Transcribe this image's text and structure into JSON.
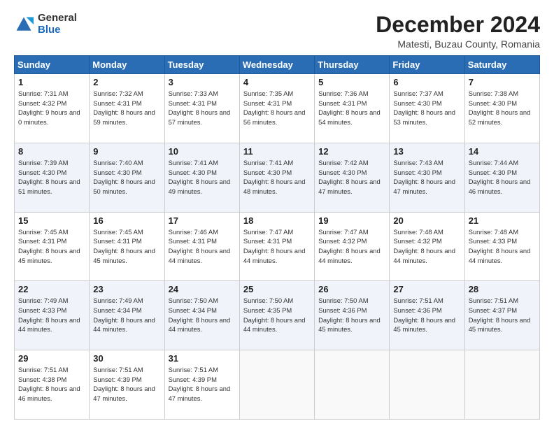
{
  "logo": {
    "general": "General",
    "blue": "Blue"
  },
  "header": {
    "title": "December 2024",
    "subtitle": "Matesti, Buzau County, Romania"
  },
  "days_of_week": [
    "Sunday",
    "Monday",
    "Tuesday",
    "Wednesday",
    "Thursday",
    "Friday",
    "Saturday"
  ],
  "weeks": [
    [
      {
        "day": 1,
        "sunrise": "7:31 AM",
        "sunset": "4:32 PM",
        "daylight": "9 hours and 0 minutes."
      },
      {
        "day": 2,
        "sunrise": "7:32 AM",
        "sunset": "4:31 PM",
        "daylight": "8 hours and 59 minutes."
      },
      {
        "day": 3,
        "sunrise": "7:33 AM",
        "sunset": "4:31 PM",
        "daylight": "8 hours and 57 minutes."
      },
      {
        "day": 4,
        "sunrise": "7:35 AM",
        "sunset": "4:31 PM",
        "daylight": "8 hours and 56 minutes."
      },
      {
        "day": 5,
        "sunrise": "7:36 AM",
        "sunset": "4:31 PM",
        "daylight": "8 hours and 54 minutes."
      },
      {
        "day": 6,
        "sunrise": "7:37 AM",
        "sunset": "4:30 PM",
        "daylight": "8 hours and 53 minutes."
      },
      {
        "day": 7,
        "sunrise": "7:38 AM",
        "sunset": "4:30 PM",
        "daylight": "8 hours and 52 minutes."
      }
    ],
    [
      {
        "day": 8,
        "sunrise": "7:39 AM",
        "sunset": "4:30 PM",
        "daylight": "8 hours and 51 minutes."
      },
      {
        "day": 9,
        "sunrise": "7:40 AM",
        "sunset": "4:30 PM",
        "daylight": "8 hours and 50 minutes."
      },
      {
        "day": 10,
        "sunrise": "7:41 AM",
        "sunset": "4:30 PM",
        "daylight": "8 hours and 49 minutes."
      },
      {
        "day": 11,
        "sunrise": "7:41 AM",
        "sunset": "4:30 PM",
        "daylight": "8 hours and 48 minutes."
      },
      {
        "day": 12,
        "sunrise": "7:42 AM",
        "sunset": "4:30 PM",
        "daylight": "8 hours and 47 minutes."
      },
      {
        "day": 13,
        "sunrise": "7:43 AM",
        "sunset": "4:30 PM",
        "daylight": "8 hours and 47 minutes."
      },
      {
        "day": 14,
        "sunrise": "7:44 AM",
        "sunset": "4:30 PM",
        "daylight": "8 hours and 46 minutes."
      }
    ],
    [
      {
        "day": 15,
        "sunrise": "7:45 AM",
        "sunset": "4:31 PM",
        "daylight": "8 hours and 45 minutes."
      },
      {
        "day": 16,
        "sunrise": "7:45 AM",
        "sunset": "4:31 PM",
        "daylight": "8 hours and 45 minutes."
      },
      {
        "day": 17,
        "sunrise": "7:46 AM",
        "sunset": "4:31 PM",
        "daylight": "8 hours and 44 minutes."
      },
      {
        "day": 18,
        "sunrise": "7:47 AM",
        "sunset": "4:31 PM",
        "daylight": "8 hours and 44 minutes."
      },
      {
        "day": 19,
        "sunrise": "7:47 AM",
        "sunset": "4:32 PM",
        "daylight": "8 hours and 44 minutes."
      },
      {
        "day": 20,
        "sunrise": "7:48 AM",
        "sunset": "4:32 PM",
        "daylight": "8 hours and 44 minutes."
      },
      {
        "day": 21,
        "sunrise": "7:48 AM",
        "sunset": "4:33 PM",
        "daylight": "8 hours and 44 minutes."
      }
    ],
    [
      {
        "day": 22,
        "sunrise": "7:49 AM",
        "sunset": "4:33 PM",
        "daylight": "8 hours and 44 minutes."
      },
      {
        "day": 23,
        "sunrise": "7:49 AM",
        "sunset": "4:34 PM",
        "daylight": "8 hours and 44 minutes."
      },
      {
        "day": 24,
        "sunrise": "7:50 AM",
        "sunset": "4:34 PM",
        "daylight": "8 hours and 44 minutes."
      },
      {
        "day": 25,
        "sunrise": "7:50 AM",
        "sunset": "4:35 PM",
        "daylight": "8 hours and 44 minutes."
      },
      {
        "day": 26,
        "sunrise": "7:50 AM",
        "sunset": "4:36 PM",
        "daylight": "8 hours and 45 minutes."
      },
      {
        "day": 27,
        "sunrise": "7:51 AM",
        "sunset": "4:36 PM",
        "daylight": "8 hours and 45 minutes."
      },
      {
        "day": 28,
        "sunrise": "7:51 AM",
        "sunset": "4:37 PM",
        "daylight": "8 hours and 45 minutes."
      }
    ],
    [
      {
        "day": 29,
        "sunrise": "7:51 AM",
        "sunset": "4:38 PM",
        "daylight": "8 hours and 46 minutes."
      },
      {
        "day": 30,
        "sunrise": "7:51 AM",
        "sunset": "4:39 PM",
        "daylight": "8 hours and 47 minutes."
      },
      {
        "day": 31,
        "sunrise": "7:51 AM",
        "sunset": "4:39 PM",
        "daylight": "8 hours and 47 minutes."
      },
      null,
      null,
      null,
      null
    ]
  ]
}
